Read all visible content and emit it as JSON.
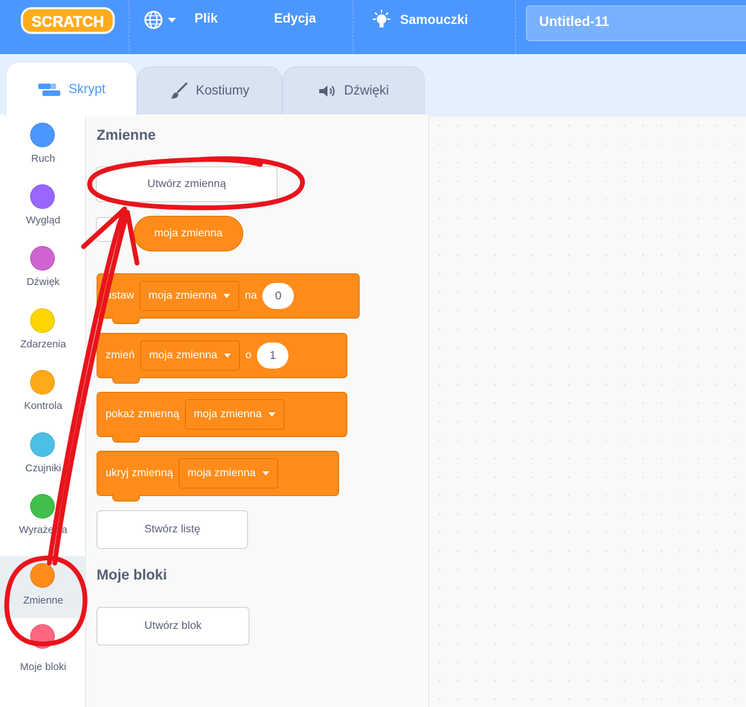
{
  "menubar": {
    "logo_text": "SCRATCH",
    "file_label": "Plik",
    "edit_label": "Edycja",
    "tutorials_label": "Samouczki",
    "project_title": "Untitled-11"
  },
  "tabs": [
    {
      "label": "Skrypt",
      "icon": "code-icon",
      "active": true
    },
    {
      "label": "Kostiumy",
      "icon": "brush-icon",
      "active": false
    },
    {
      "label": "Dźwięki",
      "icon": "speaker-icon",
      "active": false
    }
  ],
  "categories": [
    {
      "label": "Ruch",
      "color": "#4c97ff"
    },
    {
      "label": "Wygląd",
      "color": "#9966ff"
    },
    {
      "label": "Dźwięk",
      "color": "#cf63cf"
    },
    {
      "label": "Zdarzenia",
      "color": "#ffd500"
    },
    {
      "label": "Kontrola",
      "color": "#ffab19"
    },
    {
      "label": "Czujniki",
      "color": "#4cbfe6"
    },
    {
      "label": "Wyrażenia",
      "color": "#40bf4a"
    },
    {
      "label": "Zmienne",
      "color": "#ff8c1a"
    },
    {
      "label": "Moje bloki",
      "color": "#ff6680"
    }
  ],
  "palette": {
    "variables_title": "Zmienne",
    "make_variable_label": "Utwórz zmienną",
    "variable_reporter": "moja zmienna",
    "blocks": {
      "set": {
        "word": "ustaw",
        "var": "moja zmienna",
        "word2": "na",
        "value": "0"
      },
      "change": {
        "word": "zmień",
        "var": "moja zmienna",
        "word2": "o",
        "value": "1"
      },
      "show": {
        "word": "pokaż zmienną",
        "var": "moja zmienna"
      },
      "hide": {
        "word": "ukryj zmienną",
        "var": "moja zmienna"
      }
    },
    "make_list_label": "Stwórz listę",
    "my_blocks_title": "Moje bloki",
    "make_block_label": "Utwórz blok"
  },
  "colors": {
    "menubar": "#4c97ff",
    "variables": "#ff8c1a",
    "annotation": "#e8141c"
  }
}
